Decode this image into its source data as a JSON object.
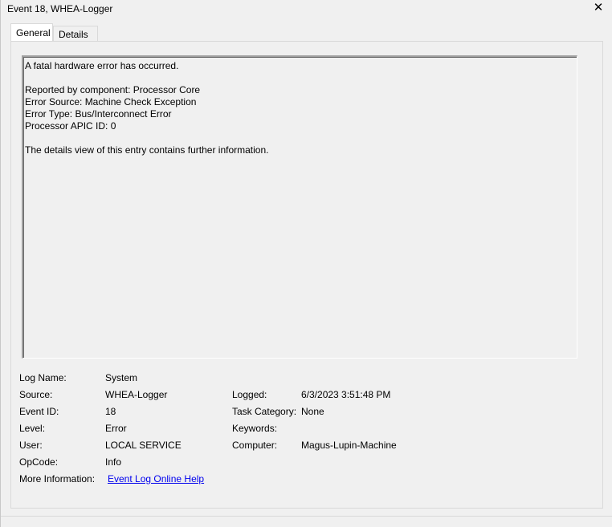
{
  "window": {
    "title": "Event 18, WHEA-Logger",
    "close_glyph": "✕"
  },
  "tabs": [
    {
      "label": "General",
      "selected": true
    },
    {
      "label": "Details",
      "selected": false
    }
  ],
  "description": {
    "lines": [
      "A fatal hardware error has occurred.",
      "",
      "Reported by component: Processor Core",
      "Error Source: Machine Check Exception",
      "Error Type: Bus/Interconnect Error",
      "Processor APIC ID: 0",
      "",
      "The details view of this entry contains further information."
    ]
  },
  "fields": {
    "log_name": {
      "label": "Log Name:",
      "value": "System"
    },
    "source": {
      "label": "Source:",
      "value": "WHEA-Logger"
    },
    "logged": {
      "label": "Logged:",
      "value": "6/3/2023 3:51:48 PM"
    },
    "event_id": {
      "label": "Event ID:",
      "value": "18"
    },
    "task_category": {
      "label": "Task Category:",
      "value": "None"
    },
    "level": {
      "label": "Level:",
      "value": "Error"
    },
    "keywords": {
      "label": "Keywords:",
      "value": ""
    },
    "user": {
      "label": "User:",
      "value": "LOCAL SERVICE"
    },
    "computer": {
      "label": "Computer:",
      "value": "Magus-Lupin-Machine"
    },
    "opcode": {
      "label": "OpCode:",
      "value": "Info"
    },
    "more_info": {
      "label": "More Information:",
      "link": "Event Log Online Help"
    }
  },
  "colors": {
    "background": "#f0f0f0",
    "link": "#0000ee"
  }
}
